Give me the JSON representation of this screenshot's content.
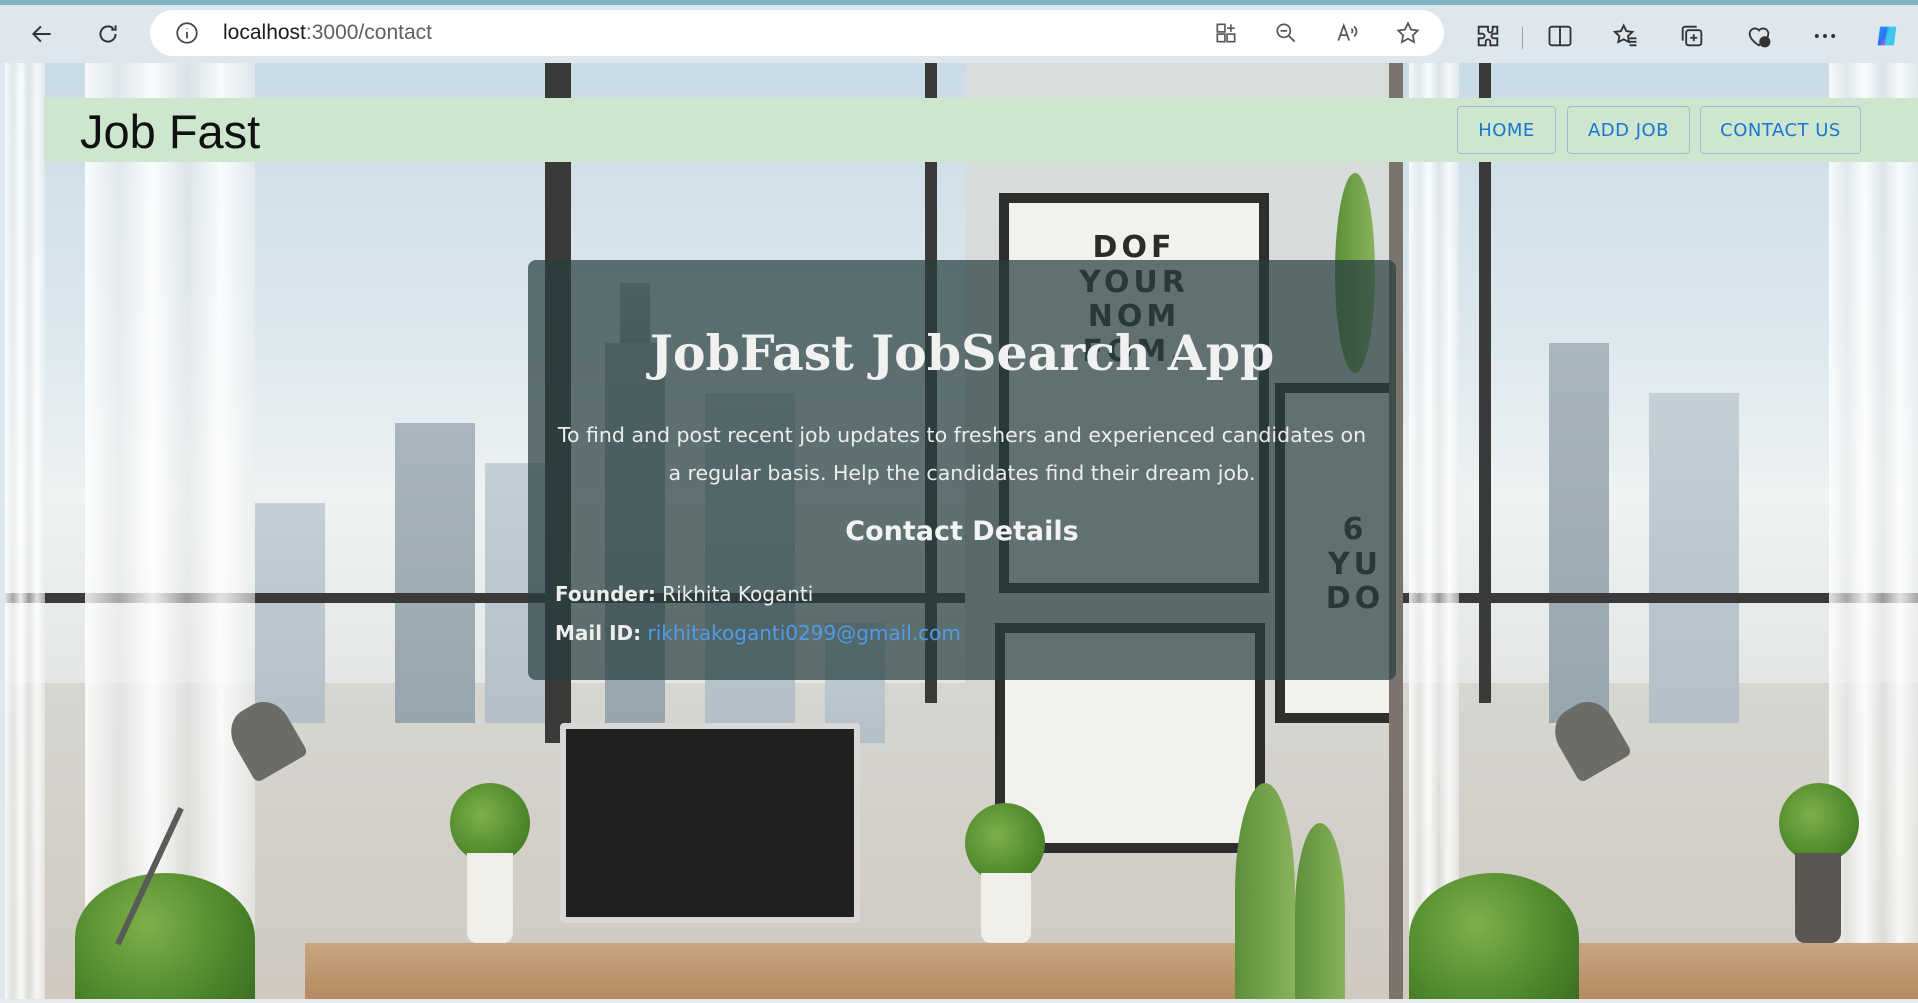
{
  "browser": {
    "url_host": "localhost",
    "url_path": ":3000/contact",
    "icons": [
      "back-icon",
      "refresh-icon",
      "site-info-icon",
      "app-available-icon",
      "zoom-out-icon",
      "read-aloud-icon",
      "favorite-star-icon",
      "extensions-icon",
      "split-screen-icon",
      "favorites-icon",
      "collections-icon",
      "browser-essentials-icon",
      "more-icon",
      "copilot-icon"
    ]
  },
  "navbar": {
    "brand": "Job Fast",
    "links": [
      "HOME",
      "ADD JOB",
      "CONTACT US"
    ]
  },
  "card": {
    "title": "JobFast JobSearch App",
    "description": "To find and post recent job updates to freshers and experienced candidates on a regular basis. Help the candidates find their dream job.",
    "subtitle": "Contact Details",
    "founder_label": "Founder:",
    "founder_value": "Rikhita Koganti",
    "mail_label": "Mail ID:",
    "mail_value": "rikhitakoganti0299@gmail.com"
  },
  "background": {
    "poster_text_left": "DOF\nYOUR\nNOM\nFOM.",
    "poster_text_right": "6\nYU\nDO"
  },
  "colors": {
    "navbar_bg": "#cde6cd",
    "link_color": "#1976d2",
    "card_overlay": "rgba(40,62,64,0.72)",
    "mail_link": "#4f9ce8"
  }
}
